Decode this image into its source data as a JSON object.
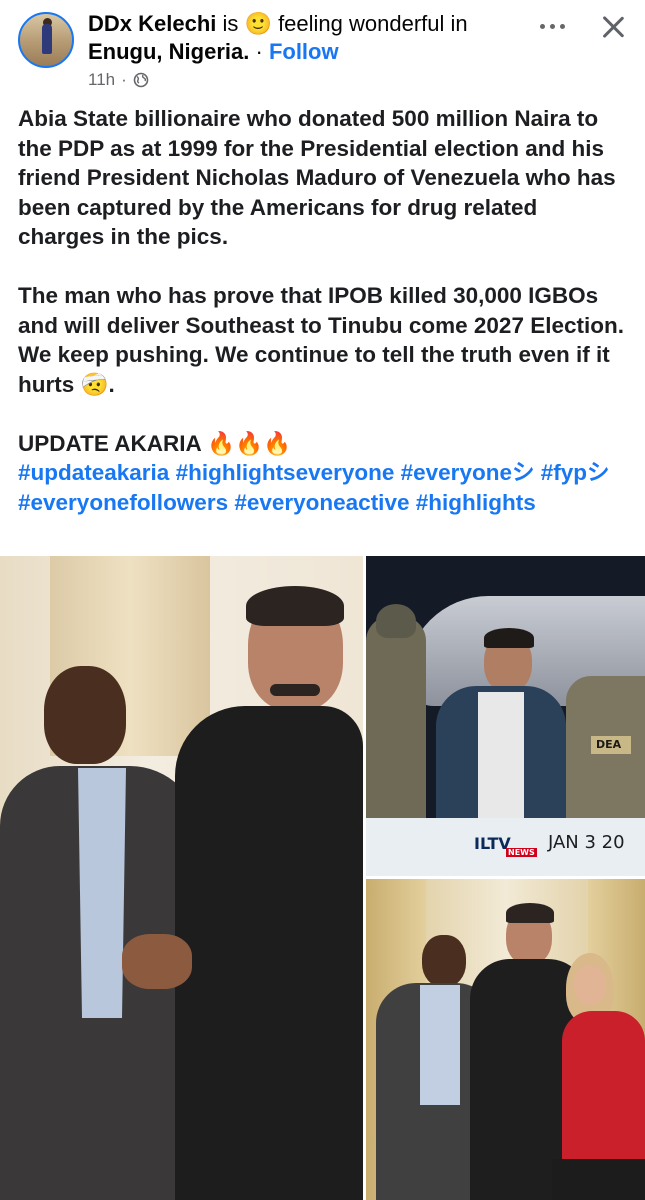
{
  "header": {
    "author_name": "DDx Kelechi",
    "is_word": "is",
    "feeling_emoji": "🙂",
    "feeling_text": "feeling wonderful",
    "in_word": "in",
    "location": "Enugu, Nigeria.",
    "separator": "·",
    "follow_label": "Follow",
    "timestamp": "11h",
    "meta_separator": "·",
    "audience_icon": "globe-icon",
    "more_icon": "more-options-icon",
    "close_icon": "close-icon"
  },
  "post": {
    "paragraph1": "Abia State billionaire who donated 500 million Naira to the PDP as at 1999 for the Presidential election and his friend President Nicholas Maduro of Venezuela who has been captured by the Americans for drug related charges in the pics.",
    "paragraph2": "The man who has prove that IPOB killed 30,000 IGBOs and will deliver Southeast to Tinubu come 2027 Election. We keep pushing. We continue to tell the truth even if it hurts 🤕.",
    "update_line": "UPDATE AKARIA 🔥🔥🔥",
    "hashtags": "#updateakaria #highlightseveryone #everyoneシ #fypシ #everyonefollowers #everyoneactive #highlights"
  },
  "photos": {
    "photo2_logo": "ILTV",
    "photo2_logo_sub": "NEWS",
    "photo2_date": "JAN 3 20",
    "photo2_badge": "DEA"
  },
  "colors": {
    "link_blue": "#1877f2",
    "text_dark": "#1c1e21",
    "meta_gray": "#65676b"
  }
}
